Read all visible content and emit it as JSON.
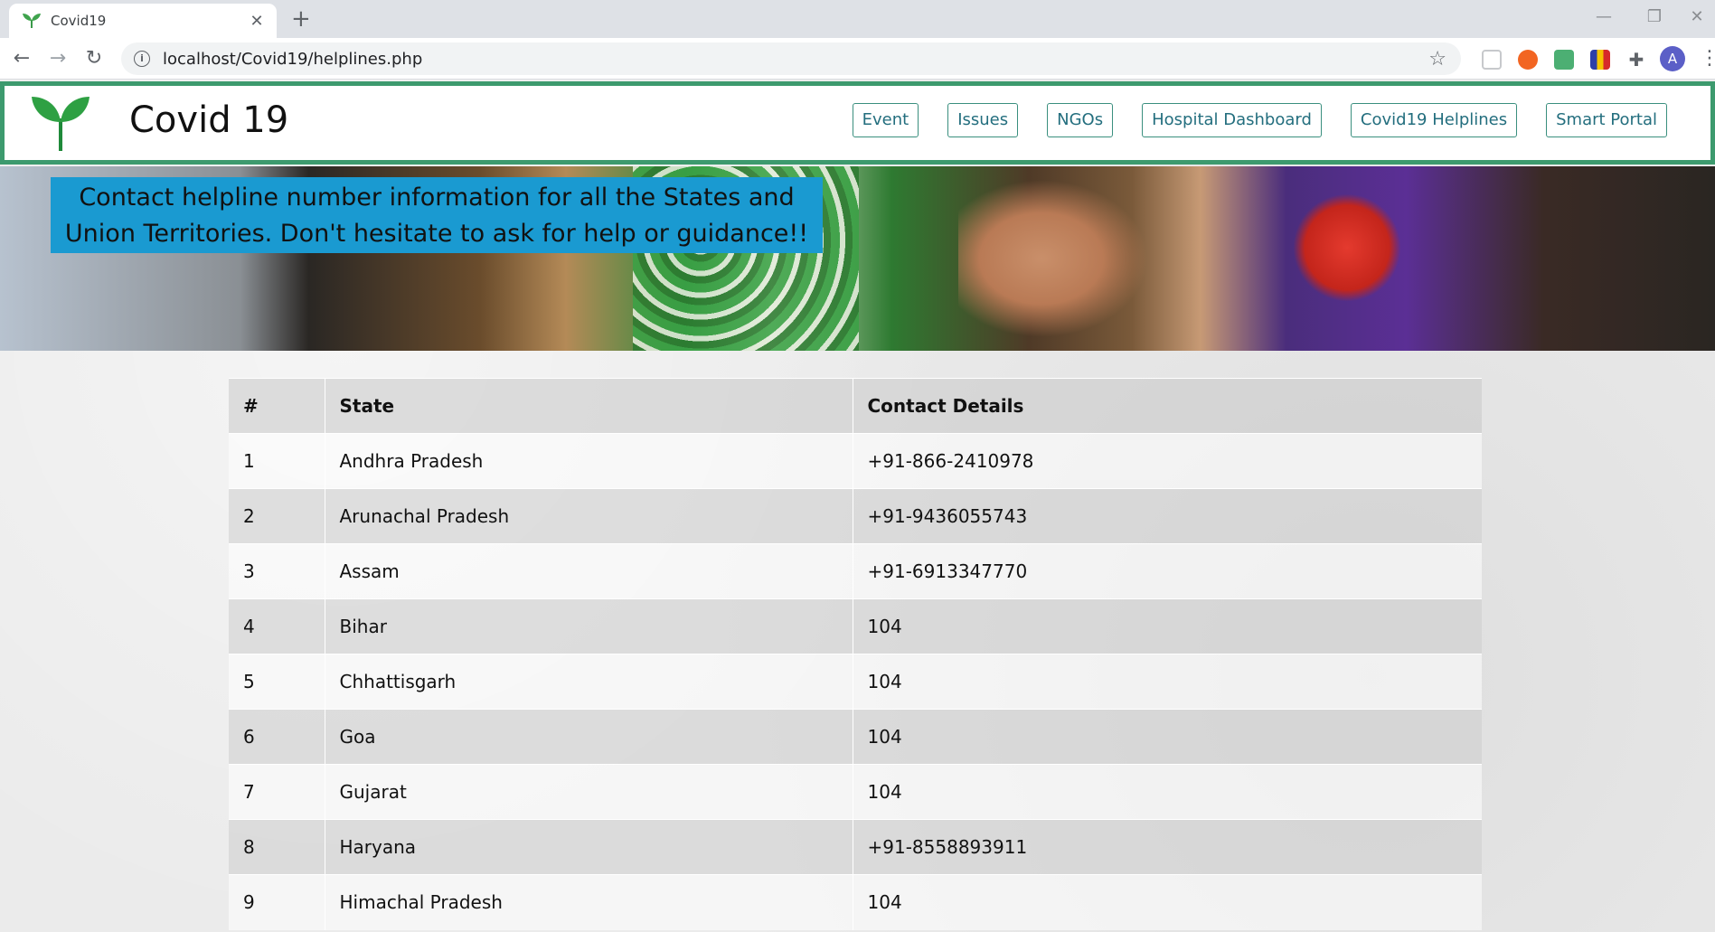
{
  "browser": {
    "tab_title": "Covid19",
    "url": "localhost/Covid19/helplines.php",
    "avatar_letter": "A",
    "colors": {
      "avatar": "#5b5fc7"
    }
  },
  "site": {
    "brand": "Covid 19",
    "nav": [
      {
        "label": "Event"
      },
      {
        "label": "Issues"
      },
      {
        "label": "NGOs"
      },
      {
        "label": "Hospital Dashboard"
      },
      {
        "label": "Covid19 Helplines"
      },
      {
        "label": "Smart Portal"
      }
    ],
    "hero_caption": "Contact helpline number information for all the States and Union Territories. Don't hesitate to ask for help or guidance!!",
    "colors": {
      "header_border": "#3d9a6e",
      "caption_bg": "#1a9ad1",
      "nav_text": "#236e7e"
    }
  },
  "table": {
    "headers": [
      "#",
      "State",
      "Contact Details"
    ],
    "rows": [
      [
        "1",
        "Andhra Pradesh",
        "+91-866-2410978"
      ],
      [
        "2",
        "Arunachal Pradesh",
        "+91-9436055743"
      ],
      [
        "3",
        "Assam",
        "+91-6913347770"
      ],
      [
        "4",
        "Bihar",
        "104"
      ],
      [
        "5",
        "Chhattisgarh",
        "104"
      ],
      [
        "6",
        "Goa",
        "104"
      ],
      [
        "7",
        "Gujarat",
        "104"
      ],
      [
        "8",
        "Haryana",
        "+91-8558893911"
      ],
      [
        "9",
        "Himachal Pradesh",
        "104"
      ]
    ]
  }
}
